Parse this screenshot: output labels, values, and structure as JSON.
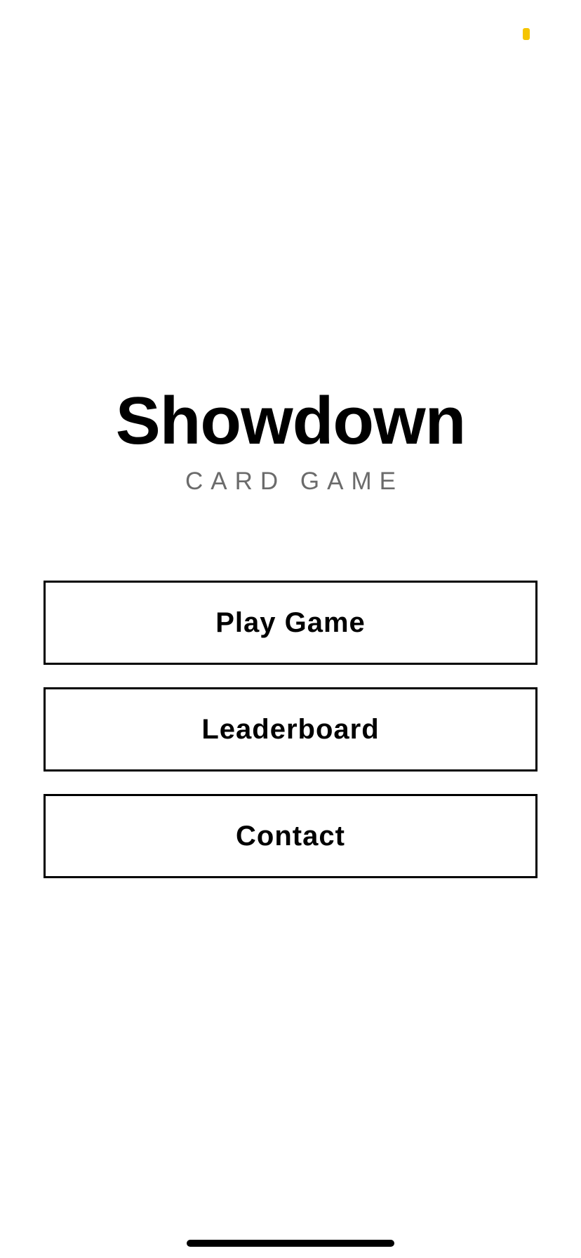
{
  "app": {
    "title": "Showdown",
    "subtitle": "CARD GAME"
  },
  "menu": {
    "items": [
      {
        "label": "Play Game"
      },
      {
        "label": "Leaderboard"
      },
      {
        "label": "Contact"
      }
    ]
  },
  "colors": {
    "background": "#ffffff",
    "text": "#000000",
    "subtitle": "#6b6b6b",
    "status_indicator": "#f5c400"
  }
}
